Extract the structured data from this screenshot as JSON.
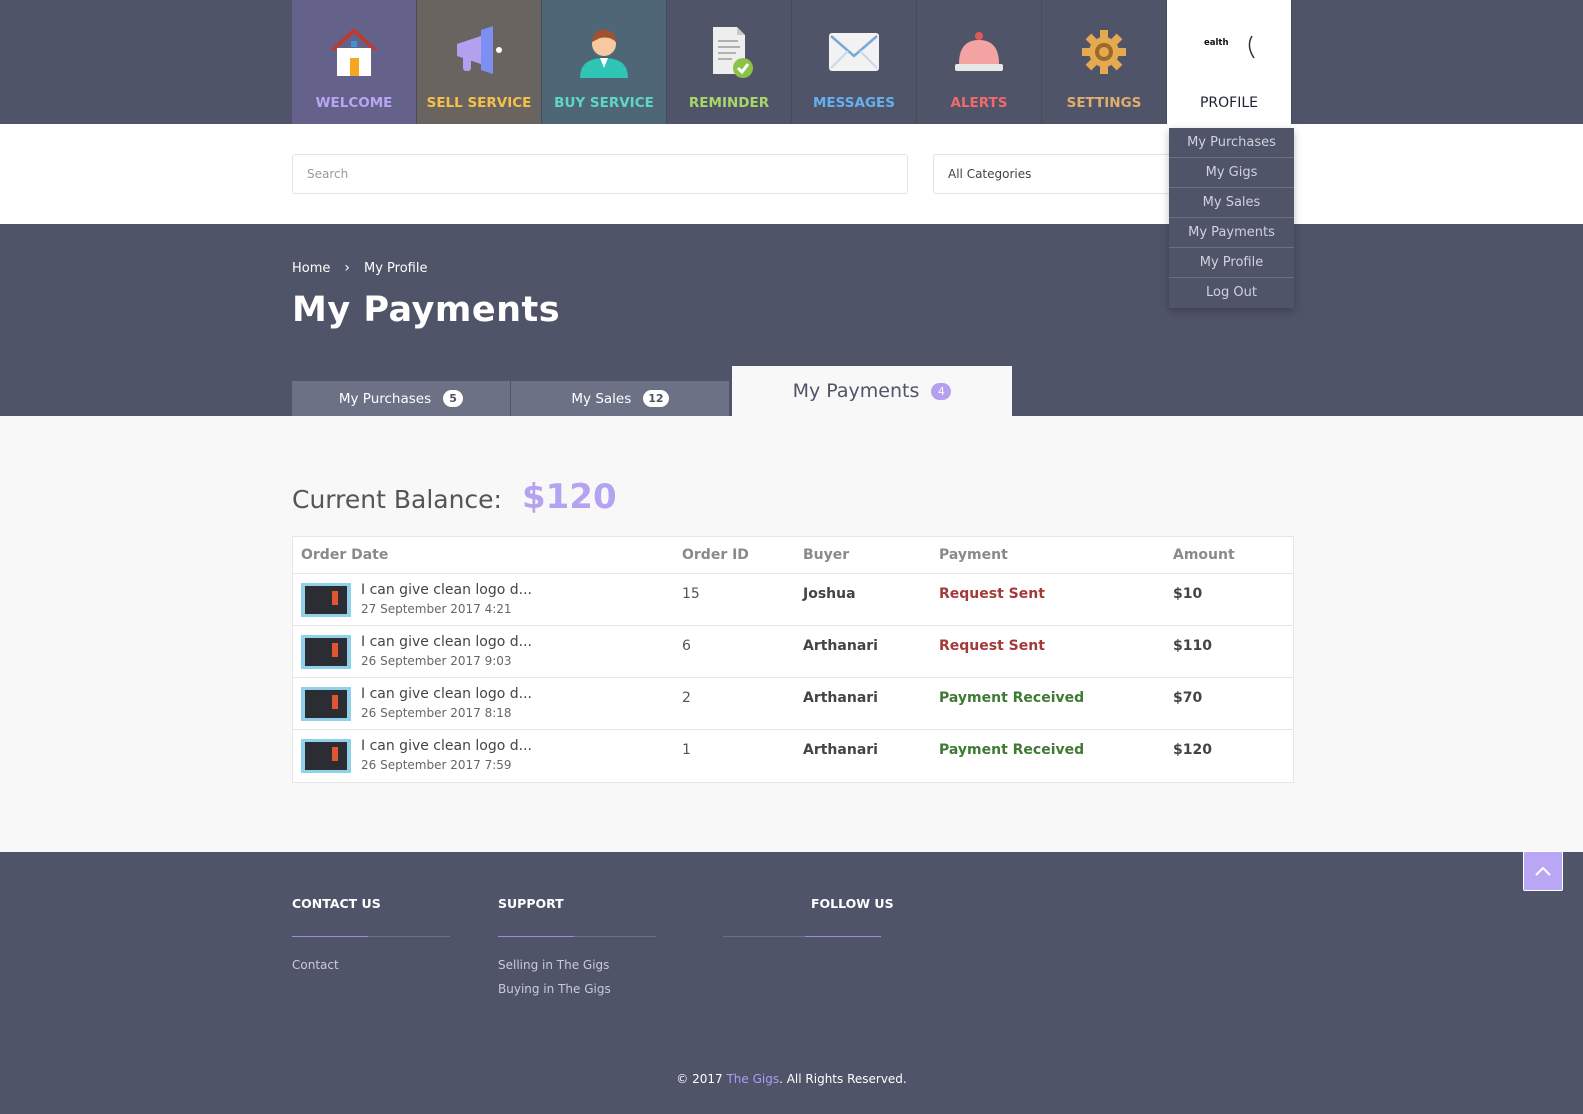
{
  "nav": [
    {
      "key": "welcome",
      "label": "WELCOME",
      "color": "#b9a6f2",
      "bg": "#64618a",
      "icon": "house-icon"
    },
    {
      "key": "sell",
      "label": "SELL SERVICE",
      "color": "#f5c14b",
      "bg": "#6a6461",
      "icon": "megaphone-icon"
    },
    {
      "key": "buy",
      "label": "BUY SERVICE",
      "color": "#5fd7c8",
      "bg": "#4f6676",
      "icon": "user-icon"
    },
    {
      "key": "reminder",
      "label": "REMINDER",
      "color": "#a8d66b",
      "bg": "#4f5468",
      "icon": "document-check-icon"
    },
    {
      "key": "messages",
      "label": "MESSAGES",
      "color": "#66b0f0",
      "bg": "#4f5468",
      "icon": "envelope-icon"
    },
    {
      "key": "alerts",
      "label": "ALERTS",
      "color": "#f06a6a",
      "bg": "#4f5468",
      "icon": "bell-icon"
    },
    {
      "key": "settings",
      "label": "SETTINGS",
      "color": "#e1ae6e",
      "bg": "#4f5468",
      "icon": "gear-icon"
    },
    {
      "key": "profile",
      "label": "PROFILE",
      "color": "#1d2231",
      "bg": "#ffffff",
      "icon": "avatar-image",
      "avatar_text": "ealth"
    }
  ],
  "search": {
    "placeholder": "Search",
    "category": "All Categories"
  },
  "profile_menu": [
    "My Purchases",
    "My Gigs",
    "My Sales",
    "My Payments",
    "My Profile",
    "Log Out"
  ],
  "breadcrumb": {
    "home": "Home",
    "current": "My Profile"
  },
  "page_title": "My Payments",
  "tabs": [
    {
      "label": "My Purchases",
      "count": "5"
    },
    {
      "label": "My Sales",
      "count": "12"
    },
    {
      "label": "My Payments",
      "count": "4"
    }
  ],
  "balance": {
    "label": "Current Balance:",
    "value": "$120"
  },
  "table": {
    "headers": [
      "Order Date",
      "Order ID",
      "Buyer",
      "Payment",
      "Amount"
    ],
    "rows": [
      {
        "title": "I can give clean logo d...",
        "date": "27 September 2017 4:21",
        "order_id": "15",
        "buyer": "Joshua",
        "payment": "Request Sent",
        "amount": "$10"
      },
      {
        "title": "I can give clean logo d...",
        "date": "26 September 2017 9:03",
        "order_id": "6",
        "buyer": "Arthanari",
        "payment": "Request Sent",
        "amount": "$110"
      },
      {
        "title": "I can give clean logo d...",
        "date": "26 September 2017 8:18",
        "order_id": "2",
        "buyer": "Arthanari",
        "payment": "Payment Received",
        "amount": "$70"
      },
      {
        "title": "I can give clean logo d...",
        "date": "26 September 2017 7:59",
        "order_id": "1",
        "buyer": "Arthanari",
        "payment": "Payment Received",
        "amount": "$120"
      }
    ]
  },
  "payment_colors": {
    "Request Sent": "#a33a3a",
    "Payment Received": "#3f7a35"
  },
  "footer": {
    "contact_heading": "CONTACT US",
    "contact_links": [
      "Contact"
    ],
    "support_heading": "SUPPORT",
    "support_links": [
      "Selling in The Gigs",
      "Buying in The Gigs"
    ],
    "follow_heading": "FOLLOW US",
    "copyright_prefix": "© 2017 ",
    "brand": "The Gigs",
    "copyright_suffix": ". All Rights Reserved."
  }
}
